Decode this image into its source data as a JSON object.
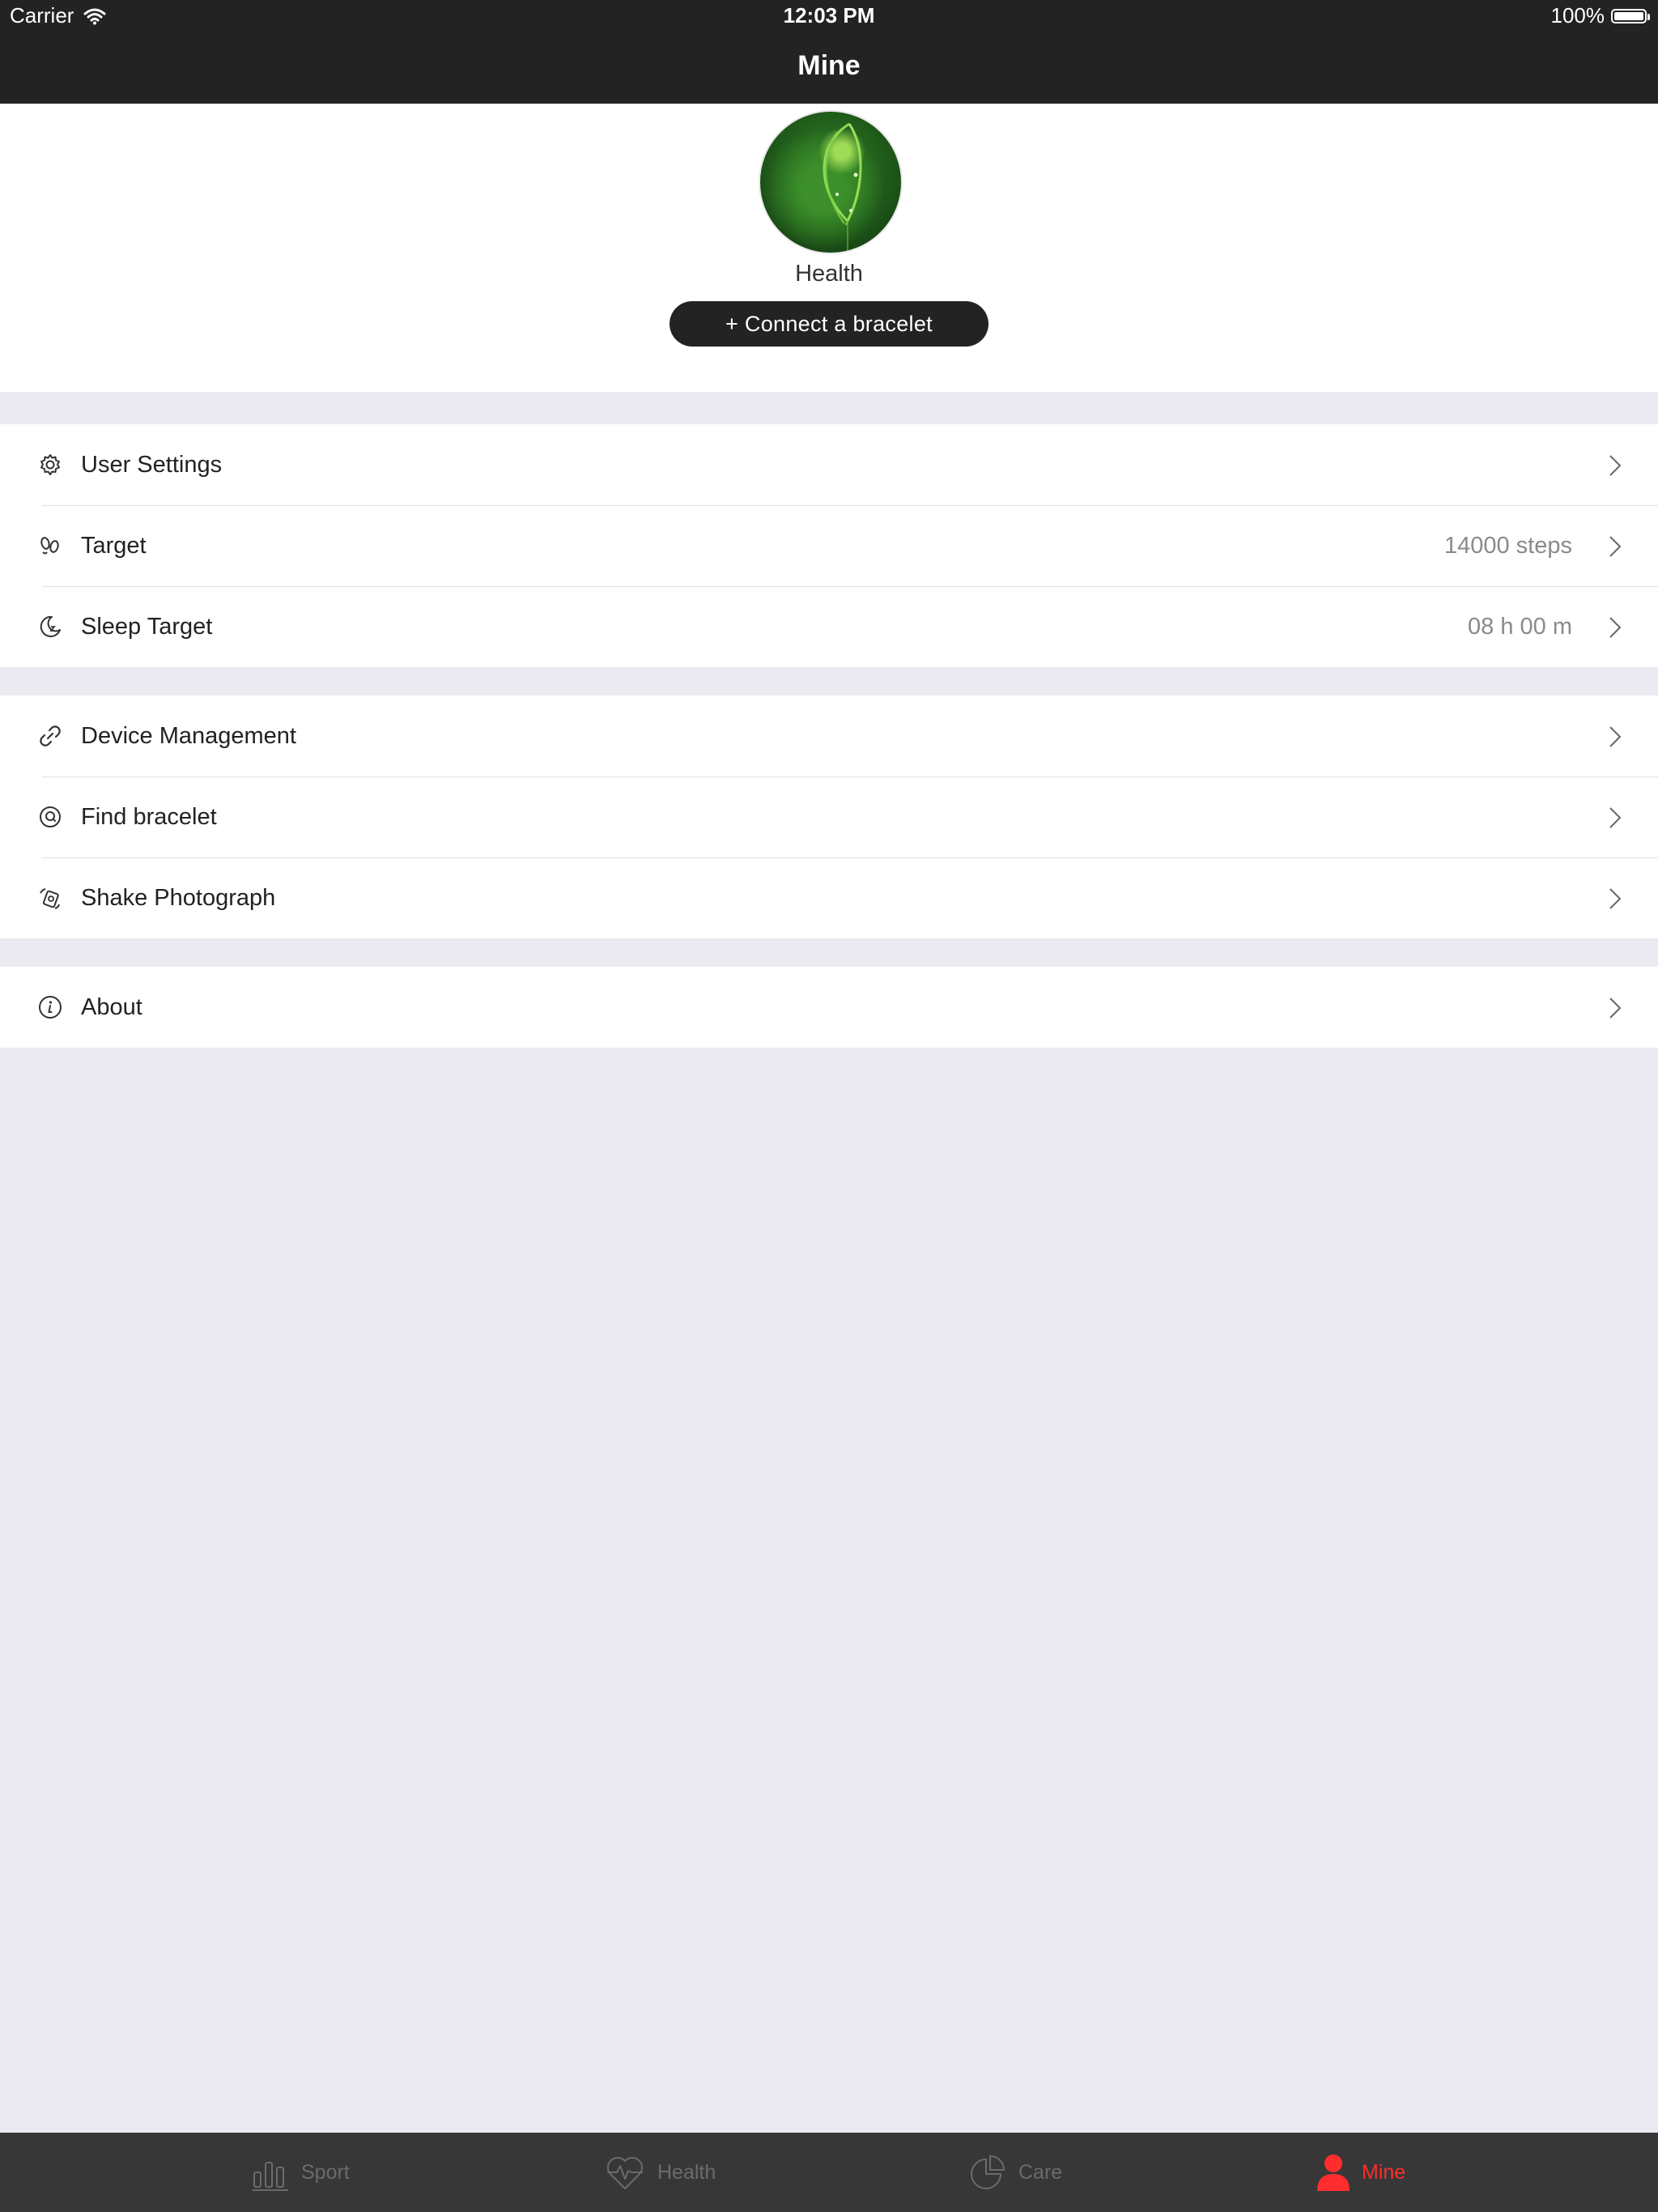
{
  "status_bar": {
    "carrier": "Carrier",
    "time": "12:03 PM",
    "battery": "100%"
  },
  "nav": {
    "title": "Mine"
  },
  "profile": {
    "name": "Health",
    "connect_label": "+ Connect a bracelet"
  },
  "groups": [
    {
      "rows": [
        {
          "label": "User Settings",
          "value": "",
          "icon": "gear-icon"
        },
        {
          "label": "Target",
          "value": "14000 steps",
          "icon": "footprints-icon"
        },
        {
          "label": "Sleep Target",
          "value": "08 h 00 m",
          "icon": "moon-icon"
        }
      ]
    },
    {
      "rows": [
        {
          "label": "Device Management",
          "value": "",
          "icon": "link-icon"
        },
        {
          "label": "Find bracelet",
          "value": "",
          "icon": "find-icon"
        },
        {
          "label": "Shake Photograph",
          "value": "",
          "icon": "shake-icon"
        }
      ]
    },
    {
      "rows": [
        {
          "label": "About",
          "value": "",
          "icon": "info-icon"
        }
      ]
    }
  ],
  "tabs": [
    {
      "label": "Sport",
      "icon": "bar-chart-icon",
      "active": false
    },
    {
      "label": "Health",
      "icon": "heart-pulse-icon",
      "active": false
    },
    {
      "label": "Care",
      "icon": "pie-chart-icon",
      "active": false
    },
    {
      "label": "Mine",
      "icon": "person-icon",
      "active": true
    }
  ],
  "colors": {
    "nav_bg": "#232323",
    "tab_bg": "#373737",
    "active_tab": "#ff2d2d",
    "background": "#ebeaf0"
  }
}
